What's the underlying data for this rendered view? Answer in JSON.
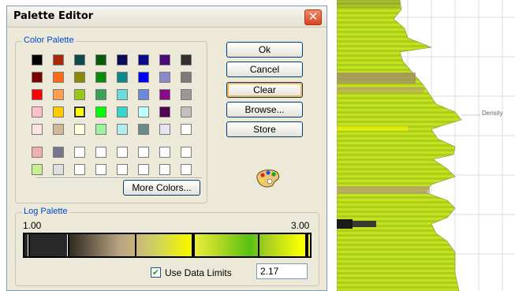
{
  "window": {
    "title": "Palette Editor",
    "close_label": "✕"
  },
  "color_palette": {
    "label": "Color Palette",
    "rows": [
      [
        "#000000",
        "#a52a0a",
        "#0e4a4a",
        "#0a5a0a",
        "#0a0a5a",
        "#0a0a8a",
        "#4a0a7a",
        "#303030"
      ],
      [
        "#7a0000",
        "#ff6a1a",
        "#8a8a0a",
        "#0a8a0a",
        "#0a8a8a",
        "#0000ff",
        "#8a8ac8",
        "#7a7a7a"
      ],
      [
        "#ff0000",
        "#ffa050",
        "#9ac81a",
        "#3aa05a",
        "#6adcdc",
        "#6a8ad8",
        "#8a0a8a",
        "#989898"
      ],
      [
        "#ffc0cc",
        "#ffcc00",
        "#ffff00",
        "#00ff00",
        "#38d6c8",
        "#c0ffff",
        "#550055",
        "#c0c0c0"
      ],
      [
        "#ffe2e2",
        "#d0b898",
        "#ffffe0",
        "#a0f2a0",
        "#b0ecec",
        "#6a8a8a",
        "#e4e4f4",
        "#ffffff"
      ]
    ],
    "selected": {
      "row": 3,
      "col": 2
    },
    "custom_rows": [
      [
        "#f0b0b0",
        "#767690",
        "#ffffff",
        "#ffffff",
        "#ffffff",
        "#ffffff",
        "#ffffff",
        "#ffffff"
      ],
      [
        "#c8f090",
        "#e0e0e0",
        "#ffffff",
        "#ffffff",
        "#ffffff",
        "#ffffff",
        "#ffffff",
        "#ffffff"
      ]
    ],
    "more_colors_label": "More Colors..."
  },
  "buttons": {
    "ok": "Ok",
    "cancel": "Cancel",
    "clear": "Clear",
    "browse": "Browse...",
    "store": "Store"
  },
  "log_palette": {
    "label": "Log Palette",
    "min": "1.00",
    "max": "3.00",
    "use_data_limits_checked": true,
    "check_glyph": "✔",
    "use_data_limits_label": "Use Data Limits",
    "limit_value": "2.17"
  },
  "track": {
    "curve_label": "Density"
  }
}
